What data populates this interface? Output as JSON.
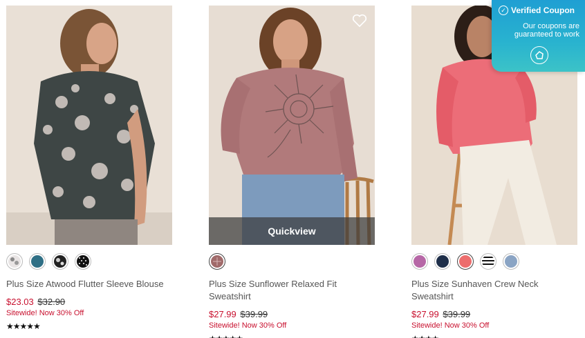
{
  "products": [
    {
      "name": "Plus Size Atwood Flutter Sleeve Blouse",
      "sale_price": "$23.03",
      "original_price": "$32.90",
      "promo": "Sitewide! Now 30% Off",
      "rating_stars": "★★★★★",
      "swatches": [
        "floral-light",
        "teal",
        "floral-black",
        "polka-dot"
      ]
    },
    {
      "name": "Plus Size Sunflower Relaxed Fit Sweatshirt",
      "sale_price": "$27.99",
      "original_price": "$39.99",
      "promo": "Sitewide! Now 30% Off",
      "rating_stars": "★★★★★",
      "quickview_label": "Quickview",
      "swatches": [
        "mauve-print"
      ]
    },
    {
      "name": "Plus Size Sunhaven Crew Neck Sweatshirt",
      "sale_price": "$27.99",
      "original_price": "$39.99",
      "promo": "Sitewide! Now 30% Off",
      "rating_stars": "★★★★",
      "swatches": [
        "orchid",
        "navy",
        "coral",
        "stripe",
        "light-blue"
      ]
    }
  ],
  "coupon": {
    "title": "Verified Coupon",
    "subtitle": "Our coupons are guaranteed to work"
  },
  "colors": {
    "sale_red": "#c8102e",
    "coupon_blue": "#1f9fd3",
    "coupon_teal": "#3cc3c7"
  }
}
